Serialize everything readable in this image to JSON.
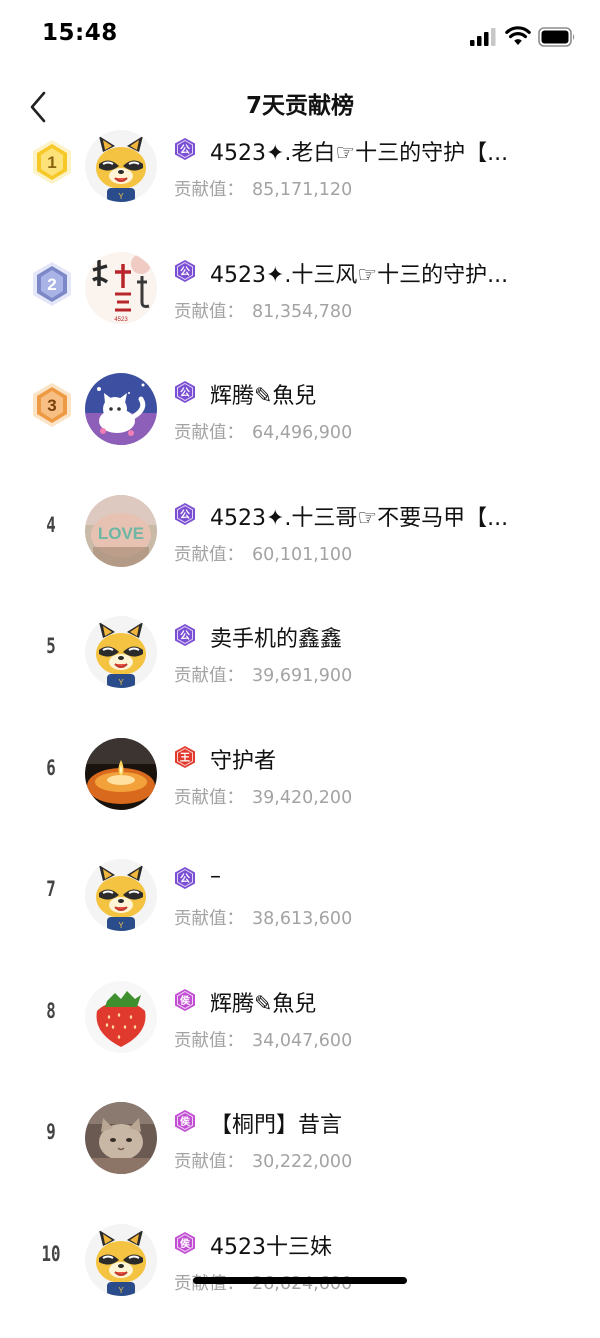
{
  "status_bar": {
    "time": "15:48"
  },
  "header": {
    "title": "7天贡献榜"
  },
  "contrib_label": "贡献值：",
  "colors": {
    "medal_gold": "#f6c928",
    "medal_silver": "#7d88c8",
    "medal_bronze": "#ee9a45",
    "badge_purple": "#7b4fd3",
    "badge_red": "#e23b2e",
    "badge_magenta": "#c24fd3",
    "value_gray": "#a3a3a3"
  },
  "rows": [
    {
      "rank": "1",
      "medal": "gold-medal-icon",
      "avatar": "raccoon-mascot-avatar",
      "badge": "公",
      "badge_icon": "guild-badge-icon",
      "name": "4523✦.老白☞十三的守护【...",
      "value": "85,171,120"
    },
    {
      "rank": "2",
      "medal": "silver-medal-icon",
      "avatar": "calligraphy-avatar",
      "badge": "公",
      "badge_icon": "guild-badge-icon",
      "name": "4523✦.十三风☞十三的守护...",
      "value": "81,354,780"
    },
    {
      "rank": "3",
      "medal": "bronze-medal-icon",
      "avatar": "cartoon-cat-avatar",
      "badge": "公",
      "badge_icon": "guild-badge-icon",
      "name": "辉腾✎魚兒",
      "value": "64,496,900"
    },
    {
      "rank": "4",
      "medal": "",
      "avatar": "love-photo-avatar",
      "badge": "公",
      "badge_icon": "guild-badge-icon",
      "name": "4523✦.十三哥☞不要马甲【...",
      "value": "60,101,100"
    },
    {
      "rank": "5",
      "medal": "",
      "avatar": "raccoon-mascot-avatar",
      "badge": "公",
      "badge_icon": "guild-badge-icon",
      "name": "卖手机的鑫鑫",
      "value": "39,691,900"
    },
    {
      "rank": "6",
      "medal": "",
      "avatar": "candle-avatar",
      "badge": "王",
      "badge_icon": "king-badge-icon",
      "name": "守护者",
      "value": "39,420,200"
    },
    {
      "rank": "7",
      "medal": "",
      "avatar": "raccoon-mascot-avatar",
      "badge": "公",
      "badge_icon": "guild-badge-icon",
      "name": "–",
      "value": "38,613,600"
    },
    {
      "rank": "8",
      "medal": "",
      "avatar": "strawberry-avatar",
      "badge": "侯",
      "badge_icon": "marquis-badge-icon",
      "name": "辉腾✎魚兒",
      "value": "34,047,600"
    },
    {
      "rank": "9",
      "medal": "",
      "avatar": "cat-photo-avatar",
      "badge": "侯",
      "badge_icon": "marquis-badge-icon",
      "name": "【桐門】昔言",
      "value": "30,222,000"
    },
    {
      "rank": "10",
      "medal": "",
      "avatar": "raccoon-mascot-avatar",
      "badge": "侯",
      "badge_icon": "marquis-badge-icon",
      "name": "4523十三妹",
      "value": "26,624,600"
    }
  ]
}
